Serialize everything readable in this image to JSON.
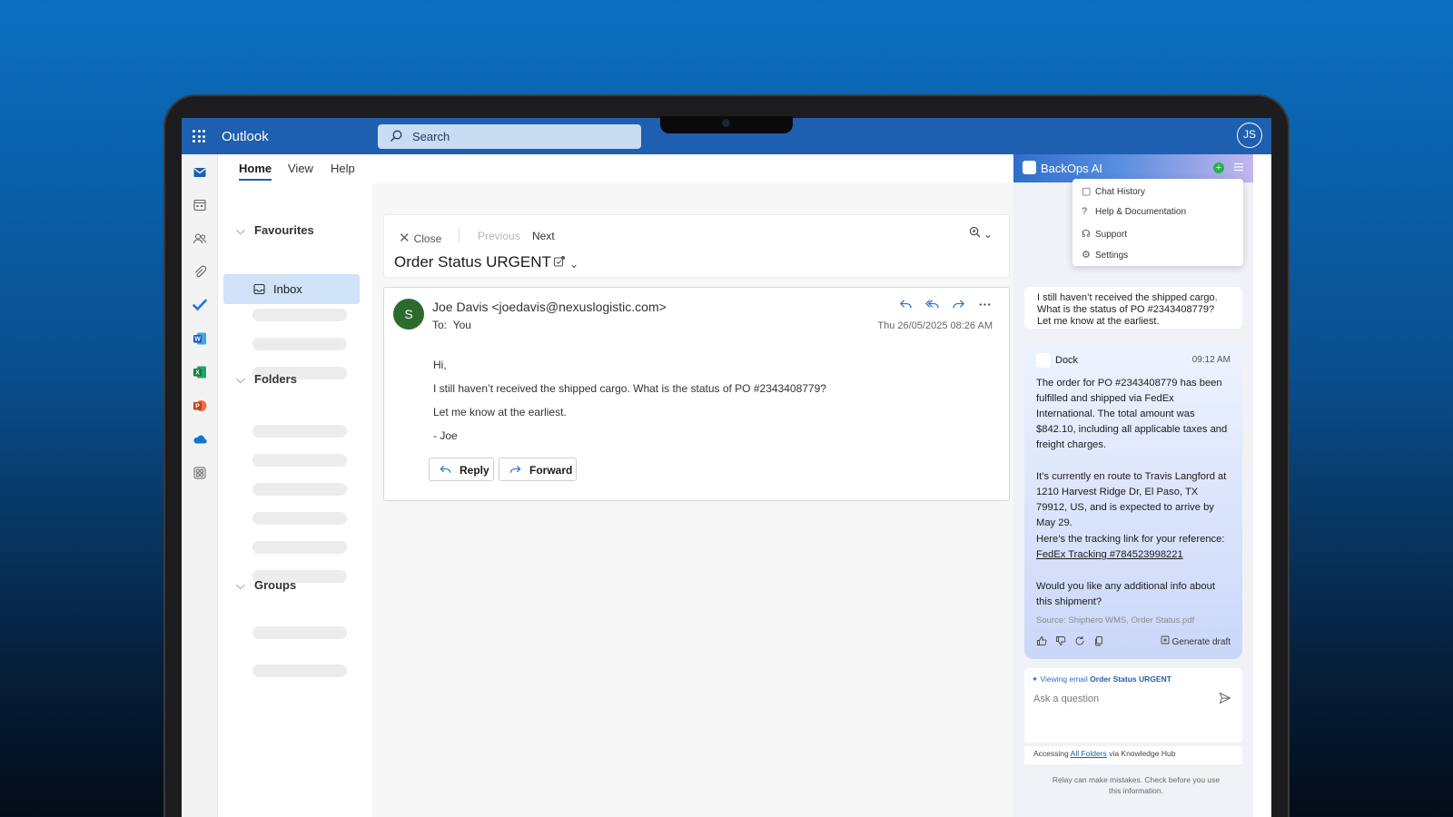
{
  "app": {
    "title": "Outlook",
    "search_placeholder": "Search",
    "user_initials": "JS"
  },
  "ribbon": {
    "tabs": [
      {
        "label": "Home",
        "active": true
      },
      {
        "label": "View"
      },
      {
        "label": "Help"
      }
    ]
  },
  "folders": {
    "favourites_label": "Favourites",
    "inbox_label": "Inbox",
    "folders_label": "Folders",
    "groups_label": "Groups"
  },
  "reading": {
    "close_label": "Close",
    "previous_label": "Previous",
    "next_label": "Next",
    "subject": "Order Status URGENT"
  },
  "email": {
    "avatar_initial": "S",
    "sender": "Joe Davis <joedavis@nexuslogistic.com>",
    "to_label": "To:",
    "to_value": "You",
    "date": "Thu 26/05/2025 08:26 AM",
    "body": [
      "Hi,",
      "I still haven’t received the shipped cargo. What is the status of PO #2343408779?",
      "Let me know at the earliest.",
      "- Joe"
    ],
    "reply_label": "Reply",
    "forward_label": "Forward"
  },
  "ai": {
    "title": "BackOps AI",
    "menu": [
      {
        "label": "Chat History",
        "icon": "chat-history-icon"
      },
      {
        "label": "Help & Documentation",
        "icon": "help-icon"
      },
      {
        "label": "Support",
        "icon": "support-icon"
      },
      {
        "label": "Settings",
        "icon": "settings-icon"
      }
    ],
    "user_message": "I still haven’t received the shipped cargo. What is the status of PO #2343408779? Let me know at the earliest.",
    "bot": {
      "name": "Dock",
      "time": "09:12 AM",
      "p1": "The order for PO #2343408779 has been fulfilled and shipped via FedEx International. The total amount was $842.10, including all applicable taxes and freight charges.",
      "p2": "It’s currently en route to Travis Langford at 1210 Harvest Ridge Dr, El Paso, TX 79912, US, and is expected to arrive by May 29.",
      "p3": "Here’s the tracking link for your reference:",
      "tracking_link": "FedEx Tracking #784523998221",
      "p4": "Would you like any additional info about this shipment?",
      "source": "Source: Shiphero WMS, Order Status.pdf",
      "generate_draft": "Generate draft"
    },
    "viewing_prefix": "Viewing email",
    "viewing_subject": "Order Status URGENT",
    "ask_placeholder": "Ask a question",
    "accessing_prefix": "Accessing",
    "accessing_link": "All Folders",
    "accessing_suffix": "via Knowledge Hub",
    "disclaimer": "Relay can make mistakes. Check before you use this information."
  },
  "colors": {
    "brand": "#1f5fb0",
    "avatar_green": "#2d6a2f",
    "selected": "#cfe2f7"
  }
}
